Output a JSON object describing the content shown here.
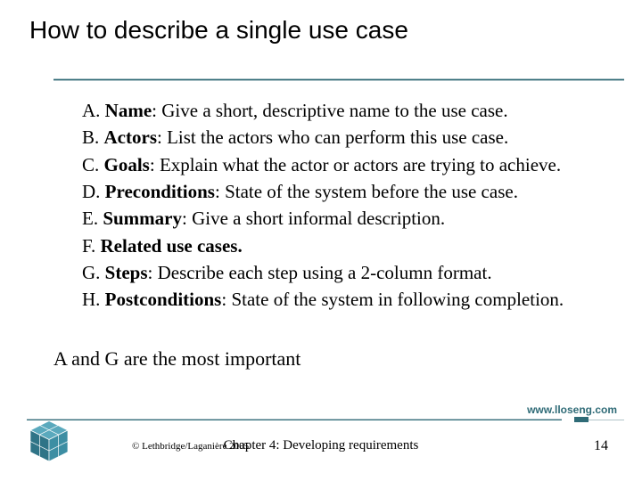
{
  "title": "How to describe a single use case",
  "items": [
    {
      "prefix": "A. ",
      "label": "Name",
      "sep": ": ",
      "desc": "Give a short, descriptive name to the use case."
    },
    {
      "prefix": "B. ",
      "label": "Actors",
      "sep": ": ",
      "desc": "List the actors who can perform this use case."
    },
    {
      "prefix": "C. ",
      "label": "Goals",
      "sep": ": ",
      "desc": "Explain what the actor or actors are trying to achieve."
    },
    {
      "prefix": "D. ",
      "label": "Preconditions",
      "sep": ": ",
      "desc": "State of the system before the use case."
    },
    {
      "prefix": "E. ",
      "label": "Summary",
      "sep": ": ",
      "desc": "Give a short informal description."
    },
    {
      "prefix": "F. ",
      "label": "Related use cases.",
      "sep": "",
      "desc": ""
    },
    {
      "prefix": "G. ",
      "label": "Steps",
      "sep": ": ",
      "desc": "Describe each step using a 2-column format."
    },
    {
      "prefix": "H. ",
      "label": "Postconditions",
      "sep": ": ",
      "desc": "State of the system in following completion."
    }
  ],
  "note": "A and G are the most important",
  "site": "www.lloseng.com",
  "copyright": "© Lethbridge/Laganière 2005",
  "chapter": "Chapter 4: Developing requirements",
  "page": "14"
}
